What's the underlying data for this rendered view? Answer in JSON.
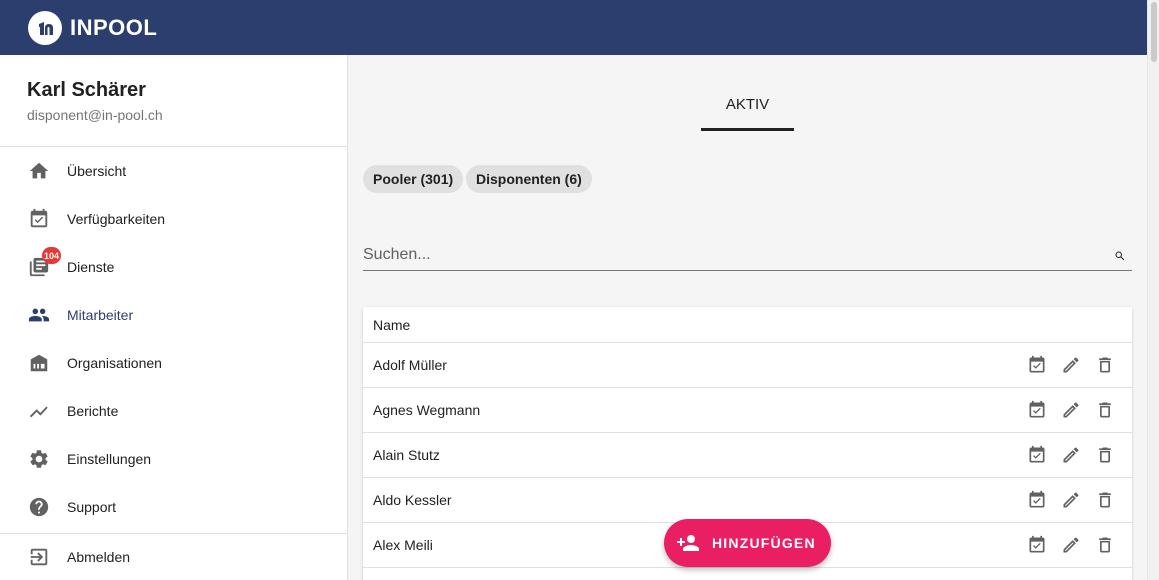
{
  "app": {
    "logo_text": "INPOOL",
    "brand_color": "#2c3e6e",
    "accent_color": "#e91e63"
  },
  "user": {
    "name": "Karl Schärer",
    "email": "disponent@in-pool.ch"
  },
  "nav": {
    "items": [
      {
        "label": "Übersicht",
        "icon": "home-icon"
      },
      {
        "label": "Verfügbarkeiten",
        "icon": "calendar-check-icon"
      },
      {
        "label": "Dienste",
        "icon": "library-icon",
        "badge": "104"
      },
      {
        "label": "Mitarbeiter",
        "icon": "people-icon",
        "active": true
      },
      {
        "label": "Organisationen",
        "icon": "store-icon"
      },
      {
        "label": "Berichte",
        "icon": "trending-icon"
      },
      {
        "label": "Einstellungen",
        "icon": "gear-icon"
      },
      {
        "label": "Support",
        "icon": "help-icon"
      },
      {
        "label": "Abmelden",
        "icon": "logout-icon"
      }
    ]
  },
  "tabs": [
    {
      "label": "AKTIV",
      "active": true
    }
  ],
  "filters": [
    {
      "label": "Pooler (301)"
    },
    {
      "label": "Disponenten (6)"
    }
  ],
  "search": {
    "placeholder": "Suchen...",
    "value": ""
  },
  "table": {
    "header": "Name",
    "rows": [
      {
        "name": "Adolf Müller"
      },
      {
        "name": "Agnes Wegmann"
      },
      {
        "name": "Alain Stutz"
      },
      {
        "name": "Aldo Kessler"
      },
      {
        "name": "Alex Meili"
      }
    ],
    "row_actions": [
      "calendar-check-icon",
      "pencil-icon",
      "trash-icon"
    ]
  },
  "fab": {
    "label": "HINZUFÜGEN",
    "icon": "person-add-icon"
  }
}
